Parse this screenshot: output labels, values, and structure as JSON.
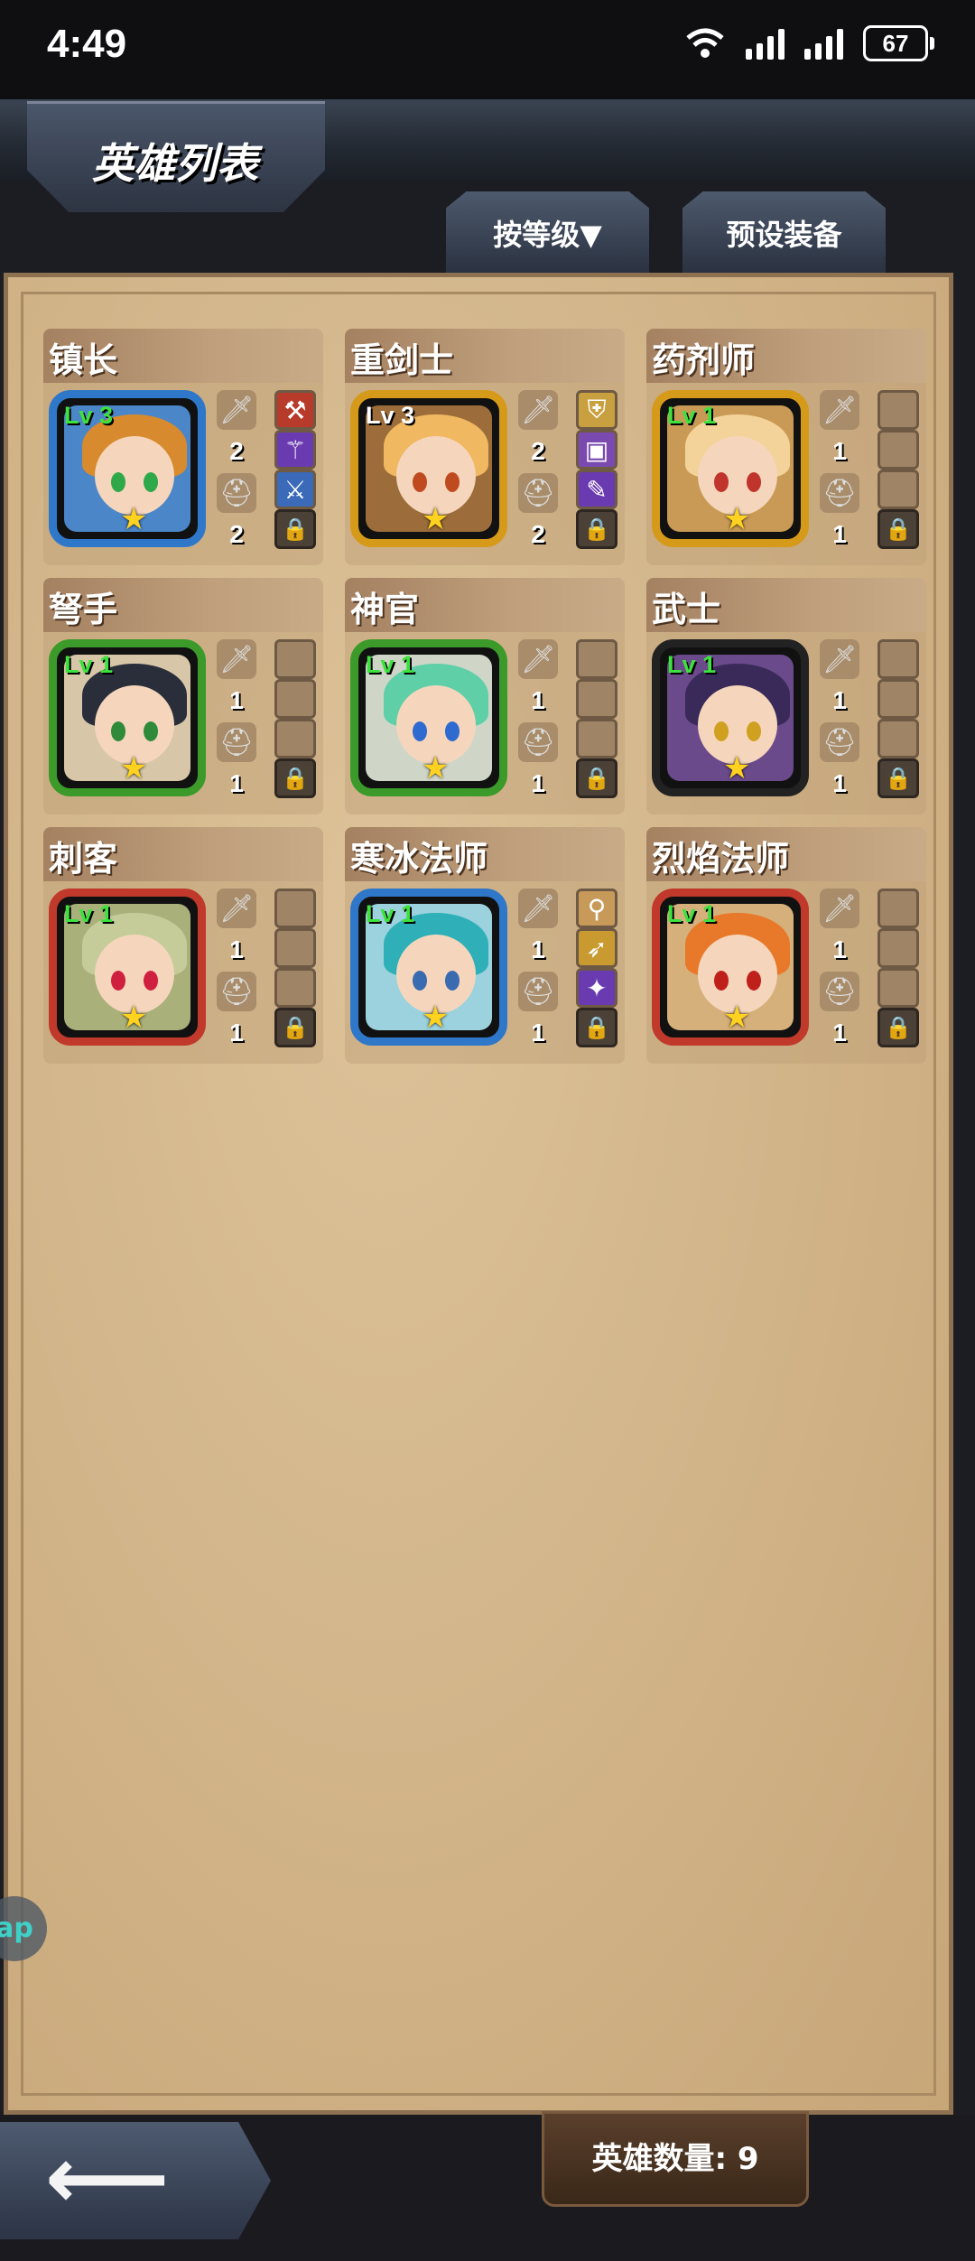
{
  "status_bar": {
    "time": "4:49",
    "battery": "67"
  },
  "header": {
    "title": "英雄列表"
  },
  "tabs": {
    "sort_label": "按等级▼",
    "preset_label": "预设装备"
  },
  "heroes": [
    {
      "name": "镇长",
      "level": "Lv 3",
      "attack": "2",
      "defense": "2",
      "frame_color": "#2f78c9",
      "art_color": "#4a86c8",
      "hair_color": "#d88a2e",
      "eye_color": "#2fa84a",
      "lv_color": "#3ee23e",
      "slots": [
        "axe-icon",
        "staff-icon",
        "sword-icon"
      ]
    },
    {
      "name": "重剑士",
      "level": "Lv 3",
      "attack": "2",
      "defense": "2",
      "frame_color": "#d69a1a",
      "art_color": "#9c6d3a",
      "hair_color": "#f0b860",
      "eye_color": "#c04a20",
      "lv_color": "#ffffff",
      "slots": [
        "shield-icon",
        "armor-icon",
        "dagger-icon"
      ]
    },
    {
      "name": "药剂师",
      "level": "Lv 1",
      "attack": "1",
      "defense": "1",
      "frame_color": "#d69a1a",
      "art_color": "#c89a55",
      "hair_color": "#f3d39a",
      "eye_color": "#c0342c",
      "lv_color": "#3ee23e",
      "slots": [
        "",
        "",
        ""
      ]
    },
    {
      "name": "弩手",
      "level": "Lv 1",
      "attack": "1",
      "defense": "1",
      "frame_color": "#3b9a2a",
      "art_color": "#d7c6a8",
      "hair_color": "#2a2e3a",
      "eye_color": "#2f8a3a",
      "lv_color": "#3ee23e",
      "slots": [
        "",
        "",
        ""
      ]
    },
    {
      "name": "神官",
      "level": "Lv 1",
      "attack": "1",
      "defense": "1",
      "frame_color": "#3b9a2a",
      "art_color": "#cfd6c8",
      "hair_color": "#5fcfa8",
      "eye_color": "#2f6ad0",
      "lv_color": "#3ee23e",
      "slots": [
        "",
        "",
        ""
      ]
    },
    {
      "name": "武士",
      "level": "Lv 1",
      "attack": "1",
      "defense": "1",
      "frame_color": "#222222",
      "art_color": "#6a4a8a",
      "hair_color": "#3a2a5a",
      "eye_color": "#d0a020",
      "lv_color": "#3ee23e",
      "slots": [
        "",
        "",
        ""
      ]
    },
    {
      "name": "刺客",
      "level": "Lv 1",
      "attack": "1",
      "defense": "1",
      "frame_color": "#c0392b",
      "art_color": "#a9b07a",
      "hair_color": "#c5cc9a",
      "eye_color": "#d02040",
      "lv_color": "#3ee23e",
      "slots": [
        "",
        "",
        ""
      ]
    },
    {
      "name": "寒冰法师",
      "level": "Lv 1",
      "attack": "1",
      "defense": "1",
      "frame_color": "#2f78c9",
      "art_color": "#9bd2de",
      "hair_color": "#2fb0b8",
      "eye_color": "#3a6ab0",
      "lv_color": "#3ee23e",
      "slots": [
        "wand-icon",
        "bow-icon",
        "orb-icon"
      ]
    },
    {
      "name": "烈焰法师",
      "level": "Lv 1",
      "attack": "1",
      "defense": "1",
      "frame_color": "#c0392b",
      "art_color": "#d6b07a",
      "hair_color": "#e8782a",
      "eye_color": "#c0201a",
      "lv_color": "#3ee23e",
      "slots": [
        "",
        "",
        ""
      ]
    }
  ],
  "footer": {
    "hero_count": "英雄数量: 9"
  },
  "float_button": {
    "label": "ap"
  }
}
